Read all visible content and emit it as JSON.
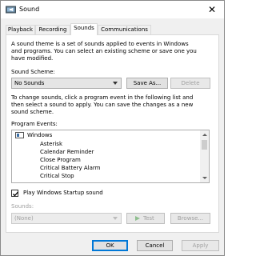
{
  "window": {
    "title": "Sound",
    "icon": "speaker-icon",
    "close_glyph": "✕"
  },
  "tabs": [
    {
      "label": "Playback",
      "active": false
    },
    {
      "label": "Recording",
      "active": false
    },
    {
      "label": "Sounds",
      "active": true
    },
    {
      "label": "Communications",
      "active": false
    }
  ],
  "intro": {
    "line1": "A sound theme is a set of sounds applied to events in Windows",
    "line2": "and programs.  You can select an existing scheme or save one you",
    "line3": "have modified."
  },
  "scheme": {
    "label": "Sound Scheme:",
    "value": "No Sounds",
    "save_as": "Save As...",
    "delete": "Delete"
  },
  "instructions": {
    "line1": "To change sounds, click a program event in the following list and",
    "line2": "then select a sound to apply.  You can save the changes as a new",
    "line3": "sound scheme."
  },
  "events": {
    "label": "Program Events:",
    "group": "Windows",
    "items": [
      "Asterisk",
      "Calendar Reminder",
      "Close Program",
      "Critical Battery Alarm",
      "Critical Stop"
    ]
  },
  "startup": {
    "label": "Play Windows Startup sound",
    "checked": true
  },
  "sounds": {
    "label": "Sounds:",
    "value": "(None)",
    "test": "Test",
    "browse": "Browse..."
  },
  "footer": {
    "ok": "OK",
    "cancel": "Cancel",
    "apply": "Apply"
  },
  "colors": {
    "accent": "#0078d7",
    "disabled_text": "#a0a0a0"
  }
}
